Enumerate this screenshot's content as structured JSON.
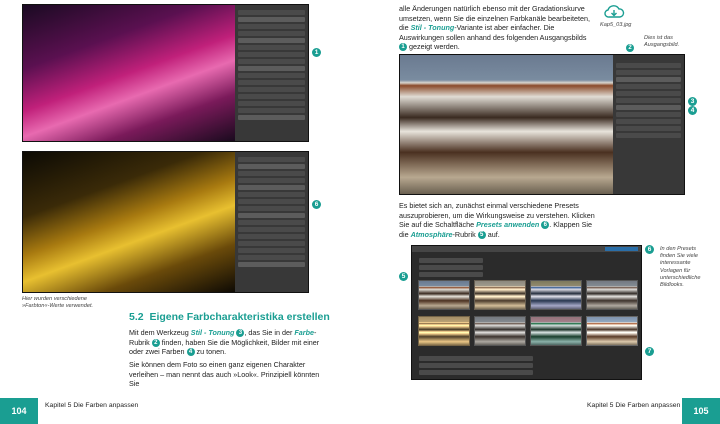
{
  "left": {
    "caption": "Hier wurden verschiedene »Farbton«-Werte verwendet.",
    "heading_num": "5.2",
    "heading": "Eigene Farbcharakteristika erstellen",
    "para1_a": "Mit dem Werkzeug ",
    "para1_tool": "Stil - Tonung",
    "para1_b": ", das Sie in der ",
    "para1_rubrik": "Farbe",
    "para1_c": "-Rubrik",
    "para1_d": " finden, haben Sie die Möglichkeit, Bilder mit einer oder zwei Farben",
    "para1_e": " zu tonen.",
    "para2": "Sie können dem Foto so einen ganz eigenen Charakter verleihen – man nennt das auch »Look«. Prinzipiell könnten Sie",
    "callout_1": "1",
    "callout_6": "6",
    "n3": "3",
    "n2": "2",
    "n4": "4",
    "page_number": "104",
    "footer": "Kapitel 5   Die Farben anpassen"
  },
  "right": {
    "para1_a": "alle Änderungen natürlich ebenso mit der Gradationskurve umsetzen, wenn Sie die einzelnen Farbkanäle bearbeiteten, die ",
    "para1_tool": "Stil - Tonung",
    "para1_b": "-Variante ist aber einfacher. Die Auswirkungen sollen anhand des folgenden Ausgangsbilds",
    "para1_c": " gezeigt werden.",
    "download_label": "Kap5_03.jpg",
    "note_top": "Dies ist das Ausgangsbild.",
    "para2_a": "Es bietet sich an, zunächst einmal verschiedene Presets auszuprobieren, um die Wirkungsweise zu verstehen. Klicken Sie auf die Schaltfläche ",
    "para2_btn": "Presets anwenden",
    "para2_b": ". Klappen Sie die ",
    "para2_rubrik": "Atmosphäre",
    "para2_c": "-Rubrik",
    "para2_d": " auf.",
    "note_right": "In den Presets finden Sie viele interessante Vorlagen für unterschiedliche Bildlooks.",
    "n1": "1",
    "n2": "2",
    "n3": "3",
    "n4": "4",
    "n5": "5",
    "n6": "6",
    "n7": "7",
    "page_number": "105",
    "footer": "Kapitel 5   Die Farben anpassen"
  }
}
